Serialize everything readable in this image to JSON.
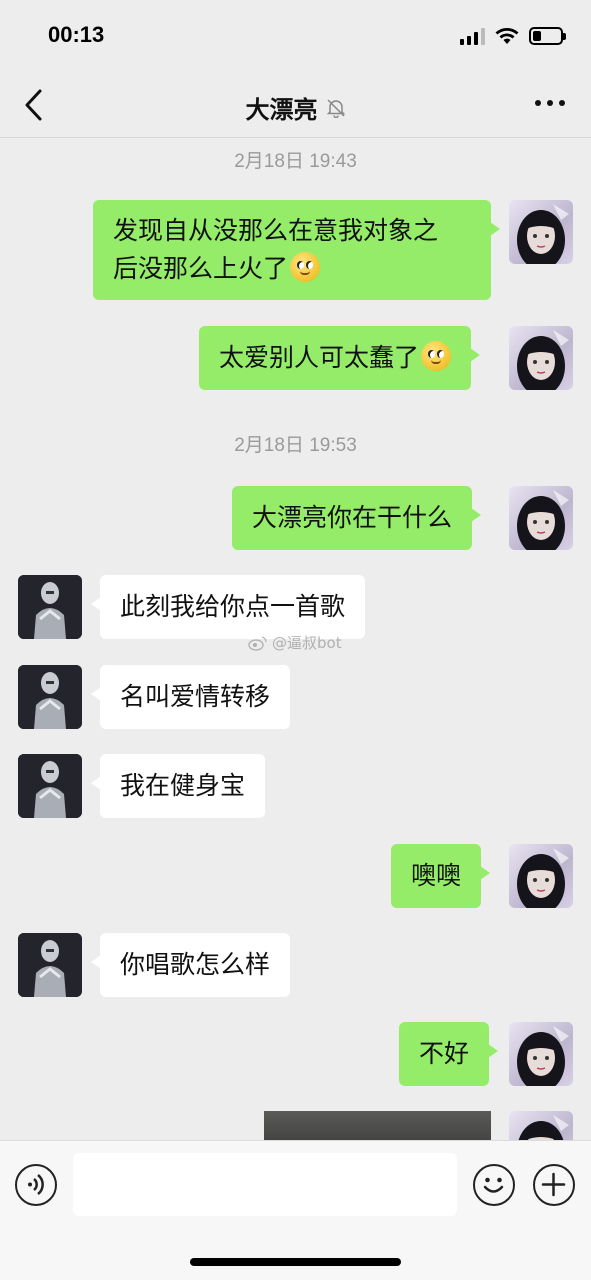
{
  "status_bar": {
    "time": "00:13",
    "battery_level": 0.2
  },
  "header": {
    "title": "大漂亮",
    "back_icon": "chevron-left-icon",
    "mute_icon": "bell-off-icon",
    "more_icon": "more-icon"
  },
  "chat": {
    "timestamps": [
      "2月18日 19:43",
      "2月18日 19:53"
    ],
    "messages": [
      {
        "sender": "me",
        "text": "发现自从没那么在意我对象之\n后没那么上火了",
        "emoji": "smile-emoji"
      },
      {
        "sender": "me",
        "text": "太爱别人可太蠢了",
        "emoji": "smile-emoji"
      },
      {
        "sender": "me",
        "text": "大漂亮你在干什么"
      },
      {
        "sender": "them",
        "text": "此刻我给你点一首歌"
      },
      {
        "sender": "them",
        "text": "名叫爱情转移"
      },
      {
        "sender": "them",
        "text": "我在健身宝"
      },
      {
        "sender": "me",
        "text": "噢噢"
      },
      {
        "sender": "them",
        "text": "你唱歌怎么样"
      },
      {
        "sender": "me",
        "text": "不好"
      },
      {
        "sender": "me",
        "type": "image"
      }
    ],
    "watermark": "@逼叔bot"
  },
  "input_bar": {
    "voice_icon": "voice-icon",
    "emoji_icon": "emoji-icon",
    "plus_icon": "plus-icon",
    "placeholder": ""
  }
}
